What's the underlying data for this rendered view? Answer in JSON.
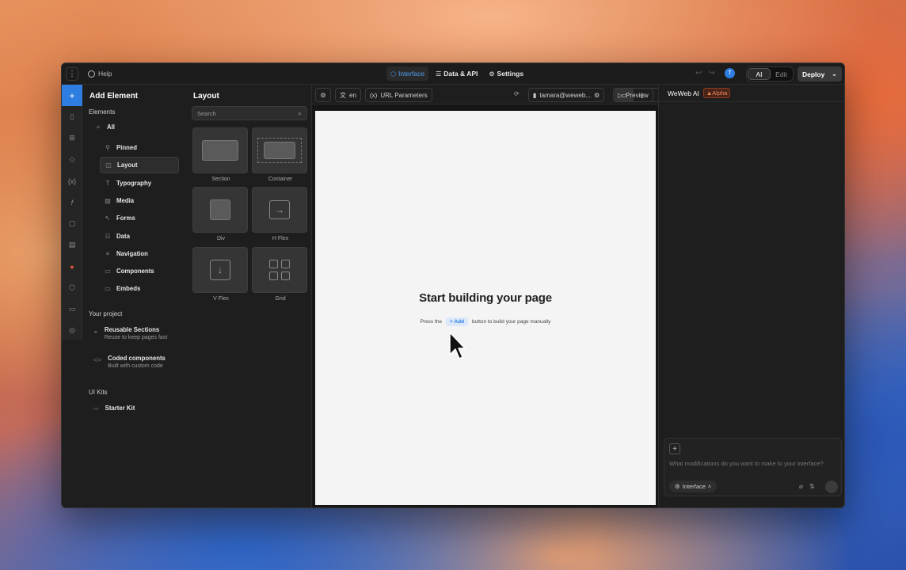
{
  "topbar": {
    "help": "Help",
    "tabs": [
      {
        "label": "Interface",
        "icon": "interface-icon"
      },
      {
        "label": "Data & API",
        "icon": "database-icon"
      },
      {
        "label": "Settings",
        "icon": "gear-icon"
      }
    ],
    "user_initial": "T",
    "mode_ai": "AI",
    "mode_edit": "Edit",
    "deploy": "Deploy"
  },
  "add_panel": {
    "title": "Add Element",
    "elements_label": "Elements",
    "categories": [
      {
        "label": "All",
        "icon": "plus-icon"
      },
      {
        "label": "Pinned",
        "icon": "pin-icon"
      },
      {
        "label": "Layout",
        "icon": "layout-icon"
      },
      {
        "label": "Typography",
        "icon": "text-icon"
      },
      {
        "label": "Media",
        "icon": "image-icon"
      },
      {
        "label": "Forms",
        "icon": "cursor-icon"
      },
      {
        "label": "Data",
        "icon": "database-icon"
      },
      {
        "label": "Navigation",
        "icon": "list-icon"
      },
      {
        "label": "Components",
        "icon": "folder-icon"
      },
      {
        "label": "Embeds",
        "icon": "folder-icon"
      }
    ],
    "project_label": "Your project",
    "project_items": [
      {
        "title": "Reusable Sections",
        "subtitle": "Reuse to keep pages fast"
      },
      {
        "title": "Coded components",
        "subtitle": "Built with custom code"
      }
    ],
    "ui_kits_label": "UI Kits",
    "starter_kit": "Starter Kit"
  },
  "layout_panel": {
    "title": "Layout",
    "search_placeholder": "Search",
    "tiles": [
      "Section",
      "Container",
      "Div",
      "H Flex",
      "V Flex",
      "Grid"
    ]
  },
  "toolbar": {
    "lang": "en",
    "url_params": "URL Parameters",
    "user": "tamara@weweb...",
    "preview": "Preview"
  },
  "canvas": {
    "title": "Start building your page",
    "hint_before": "Press the",
    "hint_chip": "Add",
    "hint_after": "button to build your page manually"
  },
  "ai_panel": {
    "title": "WeWeb AI",
    "badge": "Alpha",
    "placeholder": "What modifications do you want to make to your interface?",
    "context": "Interface"
  },
  "colors": {
    "accent": "#2e7de0",
    "panel": "#1e1e1e",
    "canvas": "#f4f4f4"
  }
}
